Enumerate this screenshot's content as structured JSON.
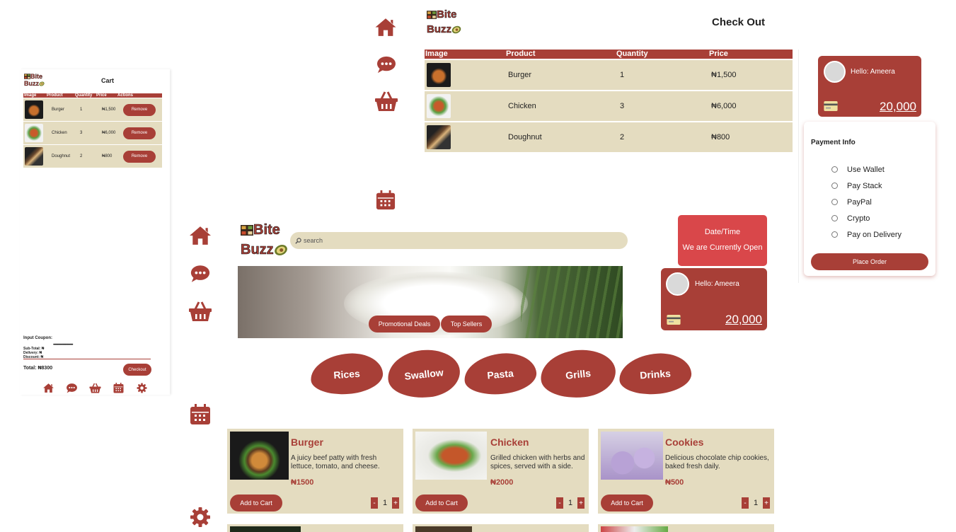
{
  "brand": {
    "name_line1": "Bite",
    "name_line2": "Buzz"
  },
  "cart": {
    "title": "Cart",
    "columns": [
      "Image",
      "Product",
      "Quantity",
      "Price",
      "Actions"
    ],
    "rows": [
      {
        "product": "Burger",
        "quantity": "1",
        "price": "₦1,500",
        "action": "Remove"
      },
      {
        "product": "Chicken",
        "quantity": "3",
        "price": "₦6,000",
        "action": "Remove"
      },
      {
        "product": "Doughnut",
        "quantity": "2",
        "price": "₦800",
        "action": "Remove"
      }
    ],
    "coupon_label": "Input Coupon:",
    "coupon_value": "•••••••••••••••••••••••••",
    "subtotal": "Sub-Total: ₦",
    "delivery": "Delivery: ₦",
    "discount": "Discount: ₦",
    "total": "Total: ₦8300",
    "checkout_label": "Checkout"
  },
  "checkout": {
    "title": "Check Out",
    "columns": [
      "Image",
      "Product",
      "Quantity",
      "Price"
    ],
    "rows": [
      {
        "product": "Burger",
        "quantity": "1",
        "price": "₦1,500"
      },
      {
        "product": "Chicken",
        "quantity": "3",
        "price": "₦6,000"
      },
      {
        "product": "Doughnut",
        "quantity": "2",
        "price": "₦800"
      }
    ]
  },
  "wallet": {
    "greeting": "Hello: Ameera",
    "balance": "20,000"
  },
  "payment": {
    "title": "Payment Info",
    "options": [
      "Use Wallet",
      "Pay Stack",
      "PayPal",
      "Crypto",
      "Pay on Delivery"
    ],
    "place_order": "Place Order"
  },
  "home": {
    "search_placeholder": "search",
    "status": {
      "line1": "Date/Time",
      "line2": "We are Currently Open"
    },
    "banner_buttons": [
      "Promotional Deals",
      "Top Sellers"
    ],
    "categories": [
      "Rices",
      "Swallow",
      "Pasta",
      "Grills",
      "Drinks"
    ],
    "products": [
      {
        "name": "Burger",
        "desc": "A juicy beef patty with fresh lettuce, tomato, and cheese.",
        "price": "₦1500",
        "add": "Add to Cart",
        "qty": "1"
      },
      {
        "name": "Chicken",
        "desc": "Grilled chicken with herbs and spices, served with a side.",
        "price": "₦2000",
        "add": "Add to Cart",
        "qty": "1"
      },
      {
        "name": "Cookies",
        "desc": "Delicious chocolate chip cookies, baked fresh daily.",
        "price": "₦500",
        "add": "Add to Cart",
        "qty": "1"
      }
    ]
  },
  "colors": {
    "brand": "#a83f37",
    "cream": "#e4dcc0",
    "status_red": "#d9474a"
  },
  "icons": [
    "home-icon",
    "chat-icon",
    "basket-icon",
    "calendar-icon",
    "gear-icon",
    "search-icon",
    "card-icon"
  ]
}
